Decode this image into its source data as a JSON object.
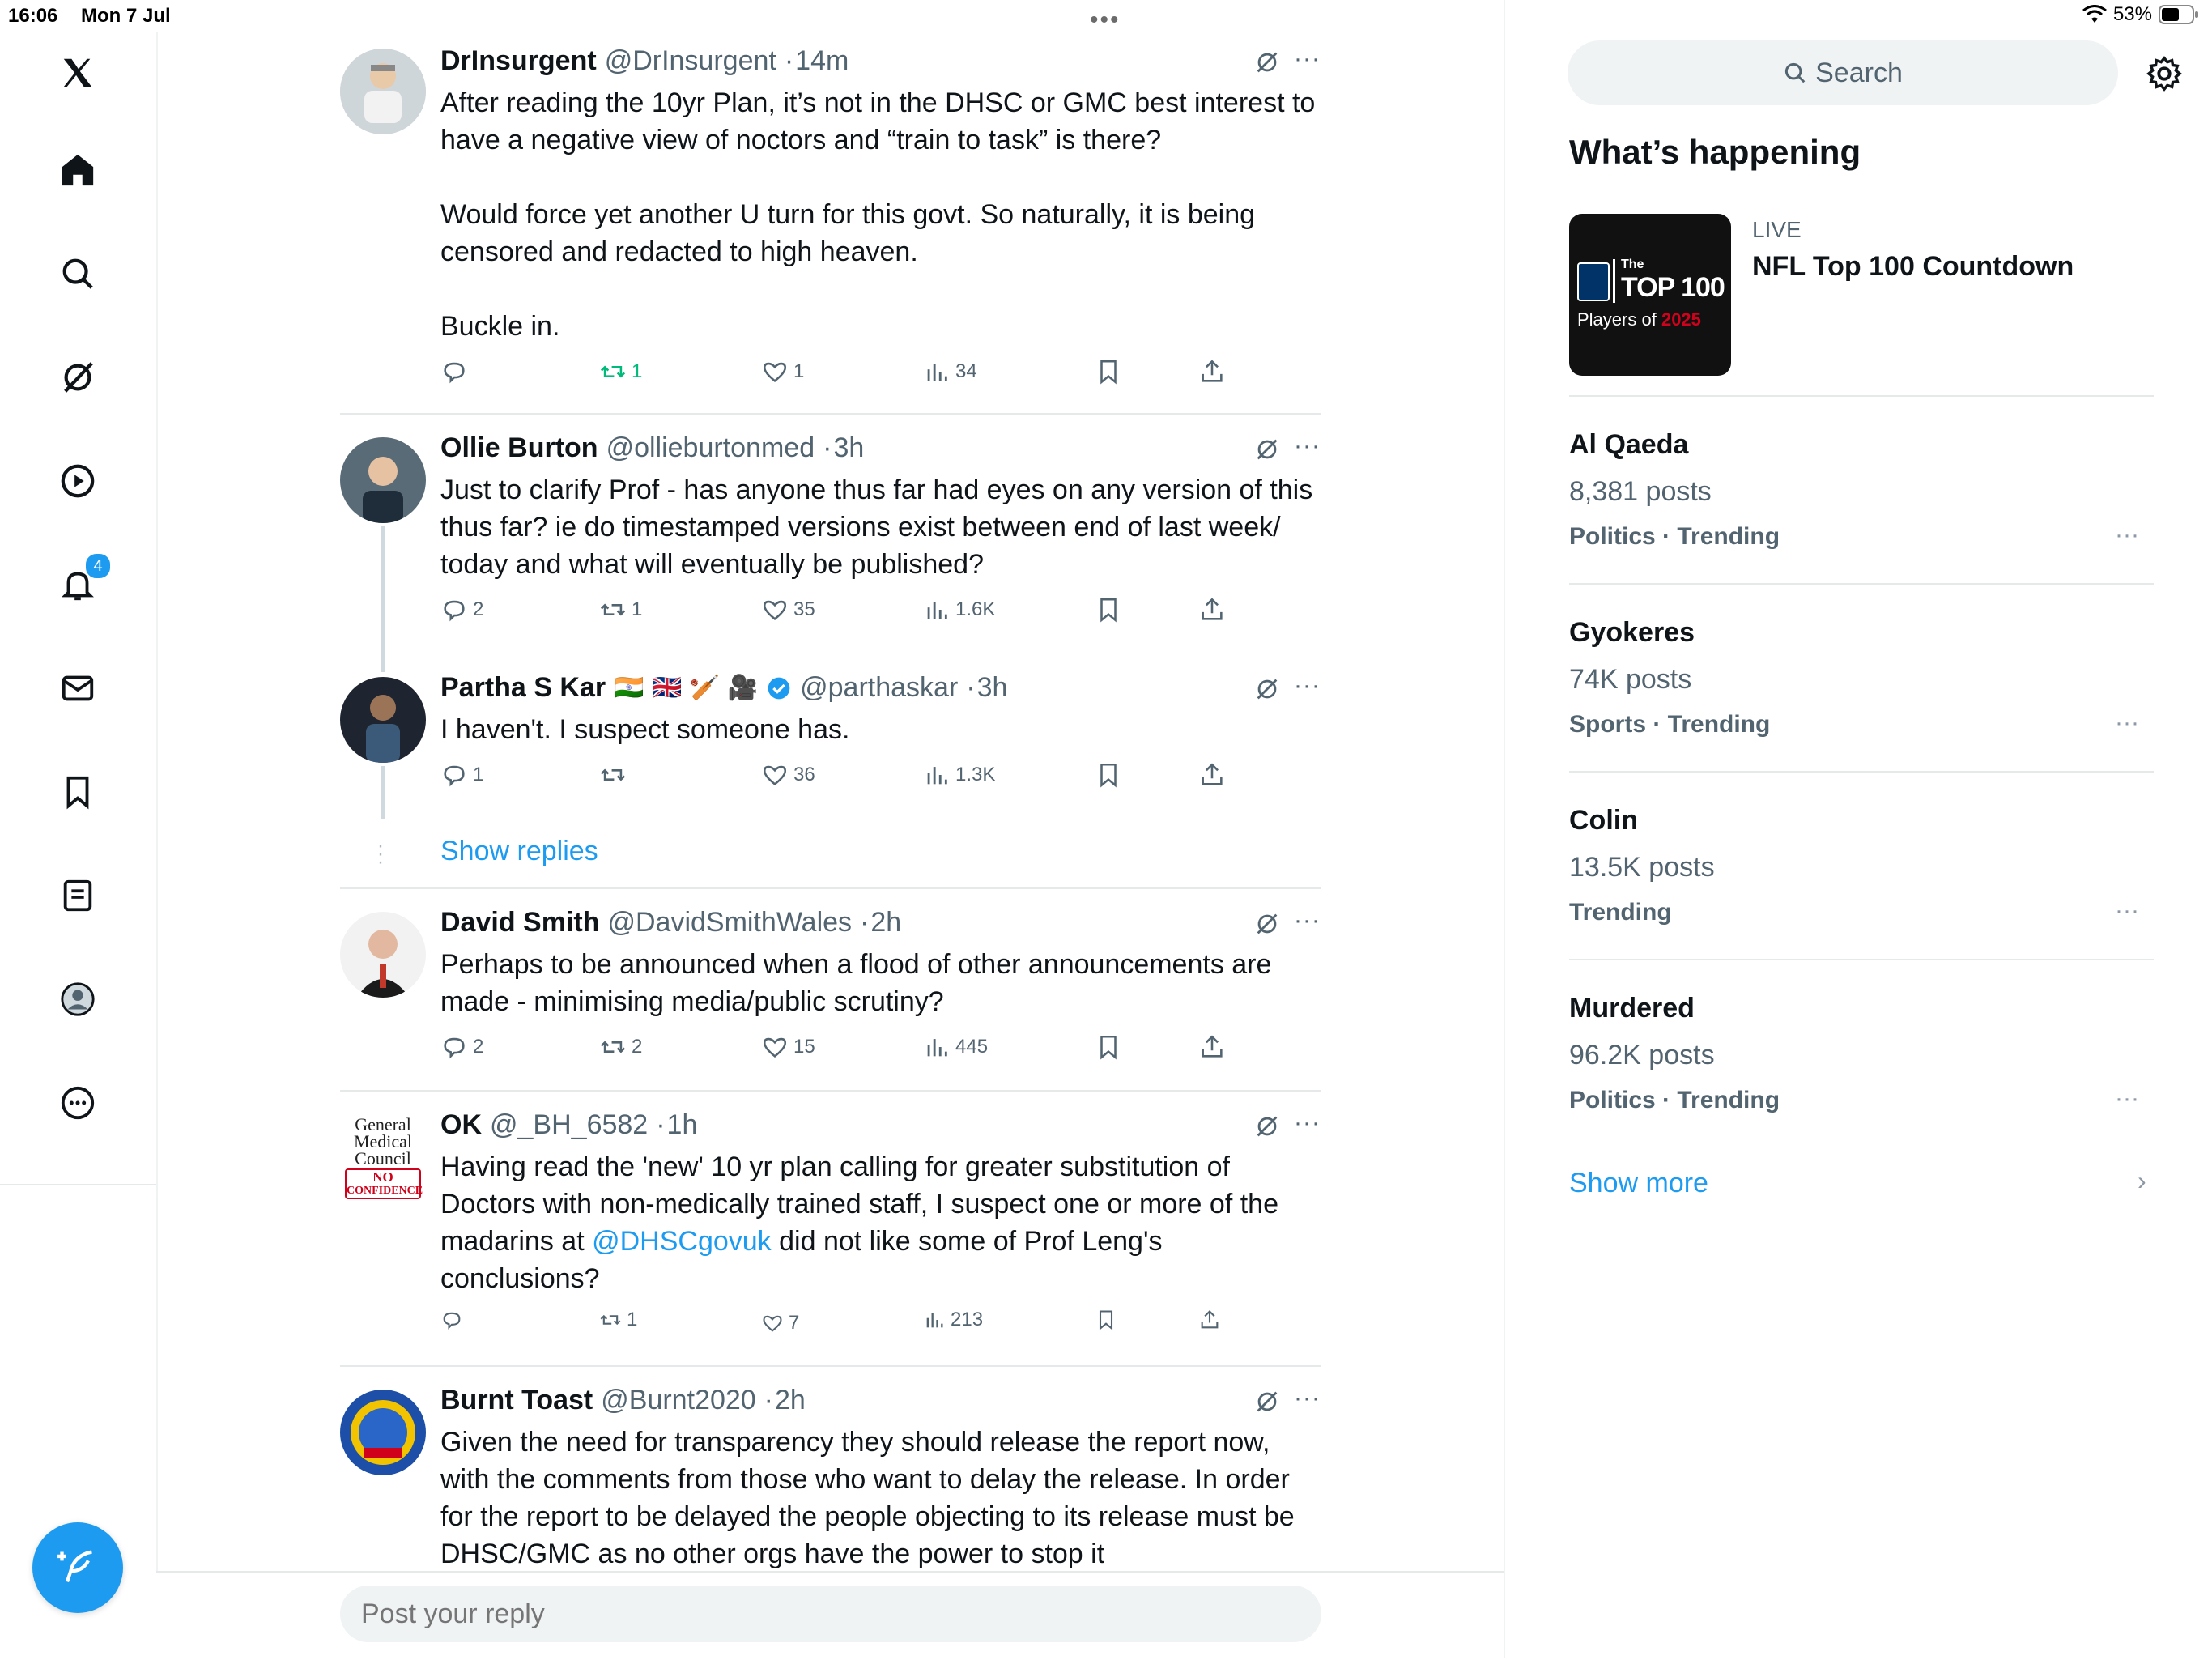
{
  "status": {
    "time": "16:06",
    "date": "Mon 7 Jul",
    "battery": "53%"
  },
  "nav": {
    "notifications_badge": "4"
  },
  "tweets": [
    {
      "name": "DrInsurgent",
      "handle": "@DrInsurgent",
      "time": "14m",
      "text": "After reading the 10yr Plan, it’s not in the DHSC or GMC best interest to have a negative view of noctors and “train to task” is there?\n\nWould force yet another U turn for this govt. So naturally, it is being censored and redacted to high heaven.\n\nBuckle in.",
      "replies": "",
      "reposts": "1",
      "likes": "1",
      "views": "34"
    },
    {
      "name": "Ollie Burton",
      "handle": "@ollieburtonmed",
      "time": "3h",
      "text": "Just to clarify Prof - has anyone thus far had eyes on any version of this thus far? ie do timestamped versions exist between end of last week/ today and what will eventually be published?",
      "replies": "2",
      "reposts": "1",
      "likes": "35",
      "views": "1.6K"
    },
    {
      "name": "Partha S Kar",
      "emojis": "🇮🇳 🇬🇧 🏏 🎥",
      "handle": "@parthaskar",
      "time": "3h",
      "text": "I haven't. I suspect someone has.",
      "replies": "1",
      "reposts": "",
      "likes": "36",
      "views": "1.3K"
    },
    {
      "name": "David Smith",
      "handle": "@DavidSmithWales",
      "time": "2h",
      "text": "Perhaps to be announced when a flood of other announcements are made - minimising media/public scrutiny?",
      "replies": "2",
      "reposts": "2",
      "likes": "15",
      "views": "445"
    },
    {
      "name": "OK",
      "handle": "@_BH_6582",
      "time": "1h",
      "text_before": "Having read the 'new' 10 yr plan calling for greater substitution of Doctors with non-medically trained staff, I suspect one or more of the madarins at ",
      "mention": "@DHSCgovuk",
      "text_after": " did not like some of Prof Leng's conclusions?",
      "replies": "",
      "reposts": "1",
      "likes": "7",
      "views": "213",
      "avatar_text": [
        "General",
        "Medical",
        "Council",
        "NO",
        "CONFIDENCE"
      ]
    },
    {
      "name": "Burnt Toast",
      "handle": "@Burnt2020",
      "time": "2h",
      "text": "Given the need for transparency they should release the report now, with the comments from those who want to delay the release. In order for the report to be delayed the people objecting to its release must be DHSC/GMC as no other orgs have the power to stop it"
    }
  ],
  "show_replies": "Show replies",
  "reply_placeholder": "Post your reply",
  "right": {
    "search_label": "Search",
    "whats_happening": "What’s happening",
    "live": {
      "label": "LIVE",
      "title": "NFL Top 100 Countdown",
      "thumb_text": {
        "the": "The",
        "top": "TOP 100",
        "players": "Players of",
        "year": "2025"
      }
    },
    "trends": [
      {
        "name": "Al Qaeda",
        "count": "8,381 posts",
        "category": "Politics · Trending"
      },
      {
        "name": "Gyokeres",
        "count": "74K posts",
        "category": "Sports · Trending"
      },
      {
        "name": "Colin",
        "count": "13.5K posts",
        "category": "Trending"
      },
      {
        "name": "Murdered",
        "count": "96.2K posts",
        "category": "Politics · Trending"
      }
    ],
    "show_more": "Show more"
  },
  "colors": {
    "accent": "#1d9bf0",
    "repost_active": "#00ba7c",
    "secondary_text": "#536471"
  }
}
